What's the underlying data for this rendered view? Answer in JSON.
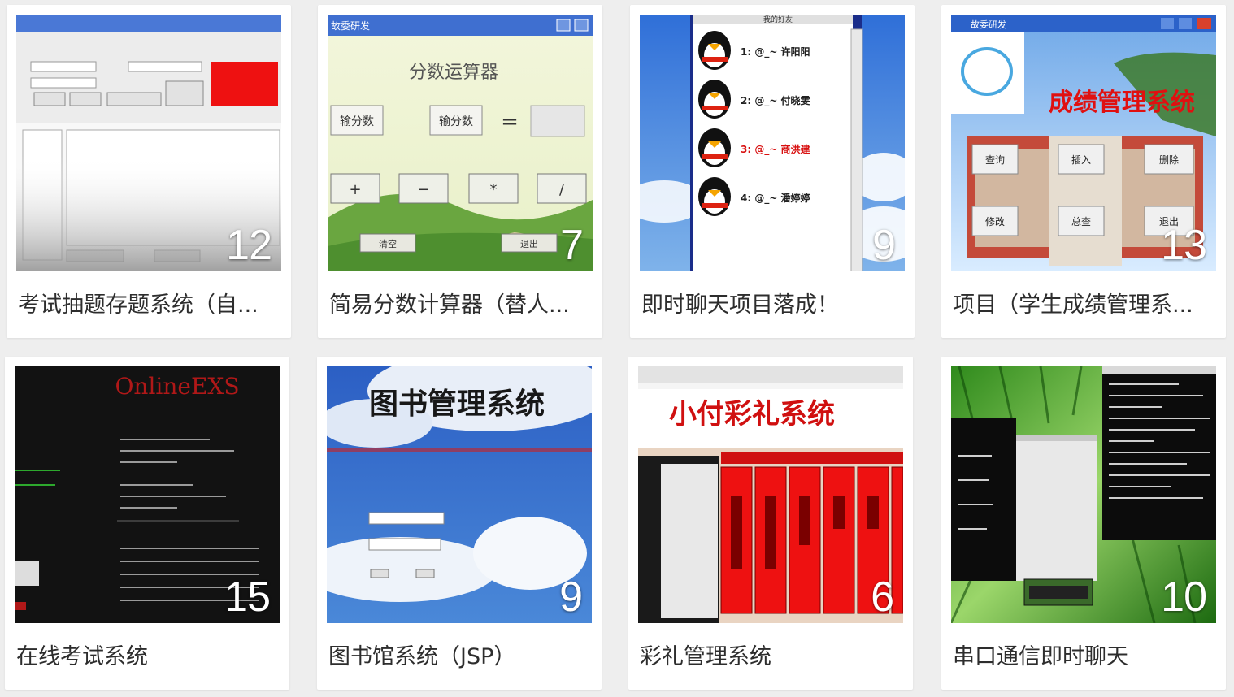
{
  "cards": [
    {
      "title": "考试抽题存题系统（自...",
      "count": "12"
    },
    {
      "title": "简易分数计算器（替人...",
      "count": "7"
    },
    {
      "title": "即时聊天项目落成！",
      "count": "9"
    },
    {
      "title": "项目（学生成绩管理系...",
      "count": "13"
    },
    {
      "title": "在线考试系统",
      "count": "15"
    },
    {
      "title": "图书馆系统（JSP）",
      "count": "9"
    },
    {
      "title": "彩礼管理系统",
      "count": "6"
    },
    {
      "title": "串口通信即时聊天",
      "count": "10"
    }
  ],
  "thumbs": {
    "calc": {
      "window_title": "故委研发",
      "heading": "分数运算器",
      "field_a": "输分数",
      "field_b": "输分数",
      "equals": "=",
      "op1": "+",
      "op2": "−",
      "op3": "*",
      "op4": "/",
      "clear": "清空",
      "exit": "退出"
    },
    "chat": {
      "header": "我的好友",
      "c1": "1: @_~ 许阳阳",
      "c2": "2: @_~ 付晓雯",
      "c3": "3: @_~ 商洪建",
      "c4": "4: @_~ 潘婷婷"
    },
    "score": {
      "window_title": "故委研发",
      "heading": "成绩管理系统",
      "b1": "查询",
      "b2": "插入",
      "b3": "删除",
      "b4": "修改",
      "b5": "总查",
      "b6": "退出"
    },
    "exam": {
      "heading": "OnlineEXS"
    },
    "lib": {
      "heading": "图书管理系统"
    },
    "gift": {
      "heading": "小付彩礼系统"
    }
  },
  "colors": {
    "page_bg": "#eeeeee",
    "card_bg": "#ffffff",
    "title_text": "#2d2d2d",
    "count_text": "#ffffff"
  }
}
